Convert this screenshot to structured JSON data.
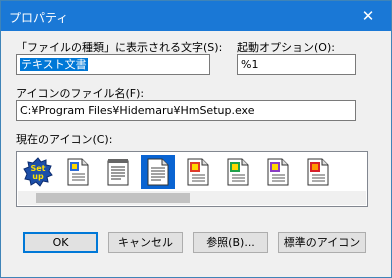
{
  "window": {
    "title": "プロパティ",
    "close_glyph": "✕"
  },
  "file_type": {
    "label": "「ファイルの種類」に表示される文字(S):",
    "value": "テキスト文書"
  },
  "startup_option": {
    "label": "起動オプション(O):",
    "value": "%1"
  },
  "icon_file": {
    "label": "アイコンのファイル名(F):",
    "value": "C:¥Program Files¥Hidemaru¥HmSetup.exe"
  },
  "current_icon": {
    "label": "現在のアイコン(C):",
    "selected_index": 3,
    "icons": [
      "setup-badge-icon",
      "document-icon-colorful-1",
      "notepad-icon",
      "document-icon-selected",
      "document-icon-colorful-2",
      "document-icon-colorful-3",
      "document-icon-colorful-4",
      "document-icon-colorful-5"
    ]
  },
  "buttons": {
    "ok": "OK",
    "cancel": "キャンセル",
    "browse": "参照(B)...",
    "default_icon": "標準のアイコン"
  },
  "colors": {
    "titlebar": "#1a78d6",
    "selection": "#0078d7",
    "dialog_bg": "#f0f0f0"
  }
}
